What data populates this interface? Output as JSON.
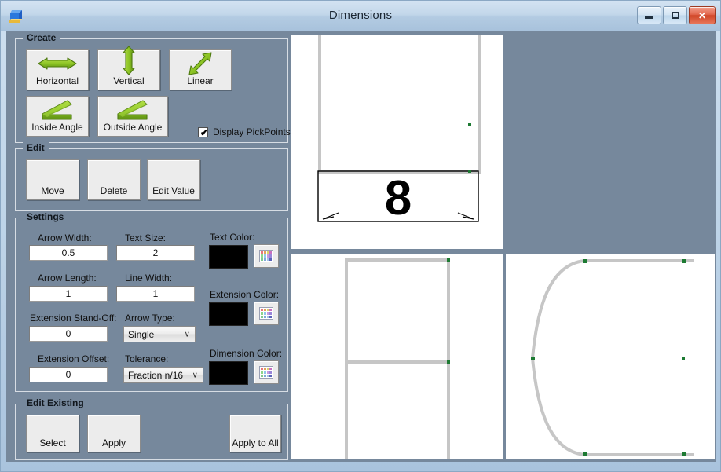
{
  "window": {
    "title": "Dimensions",
    "app_icon": "cad-window-icon",
    "controls": {
      "minimize": "minimize-button",
      "maximize": "maximize-button",
      "close": "close-button",
      "close_glyph": "✕"
    }
  },
  "create": {
    "legend": "Create",
    "buttons": [
      {
        "label": "Horizontal",
        "icon": "horizontal-arrow-icon"
      },
      {
        "label": "Vertical",
        "icon": "vertical-arrow-icon"
      },
      {
        "label": "Linear",
        "icon": "linear-arrow-icon"
      },
      {
        "label": "Inside Angle",
        "icon": "inside-angle-icon"
      },
      {
        "label": "Outside Angle",
        "icon": "outside-angle-icon"
      }
    ],
    "display_pickpoints": {
      "label": "Display PickPoints",
      "checked": true,
      "tick": "✔"
    }
  },
  "edit": {
    "legend": "Edit",
    "buttons": [
      {
        "label": "Move"
      },
      {
        "label": "Delete"
      },
      {
        "label": "Edit Value"
      }
    ]
  },
  "settings": {
    "legend": "Settings",
    "fields": [
      {
        "label": "Arrow Width:",
        "value": "0.5"
      },
      {
        "label": "Text Size:",
        "value": "2"
      },
      {
        "label": "Arrow Length:",
        "value": "1"
      },
      {
        "label": "Line Width:",
        "value": "1"
      },
      {
        "label": "Extension Stand-Off:",
        "value": "0"
      },
      {
        "label": "Extension Offset:",
        "value": "0"
      }
    ],
    "dropdowns": [
      {
        "label": "Arrow Type:",
        "value": "Single",
        "caret": "∨"
      },
      {
        "label": "Tolerance:",
        "value": "Fraction n/16",
        "caret": "∨"
      }
    ],
    "colors": [
      {
        "label": "Text Color:",
        "value": "#000000"
      },
      {
        "label": "Extension Color:",
        "value": "#000000"
      },
      {
        "label": "Dimension Color:",
        "value": "#000000"
      }
    ],
    "palette_swatches": [
      "#e8737a",
      "#e3a15c",
      "#d9d36a",
      "#c86fc0",
      "#8fd48a",
      "#8fc8e8",
      "#c79ae0",
      "#9a86d8",
      "#7fc98f",
      "#7fa8d8",
      "#a3c2e8",
      "#5b63b8"
    ]
  },
  "edit_existing": {
    "legend": "Edit Existing",
    "buttons": [
      {
        "label": "Select"
      },
      {
        "label": "Apply"
      },
      {
        "label": "Apply to All"
      }
    ]
  },
  "viewports": {
    "top": {
      "name": "front-view",
      "dimension_text": "8"
    },
    "bottom_left": {
      "name": "side-view"
    },
    "bottom_right": {
      "name": "profile-view"
    }
  },
  "theme": {
    "client_bg": "#76889c",
    "geometry_line": "#c6c6c6",
    "pickpoint": "#1d7a32",
    "dimension_line": "#000000"
  }
}
